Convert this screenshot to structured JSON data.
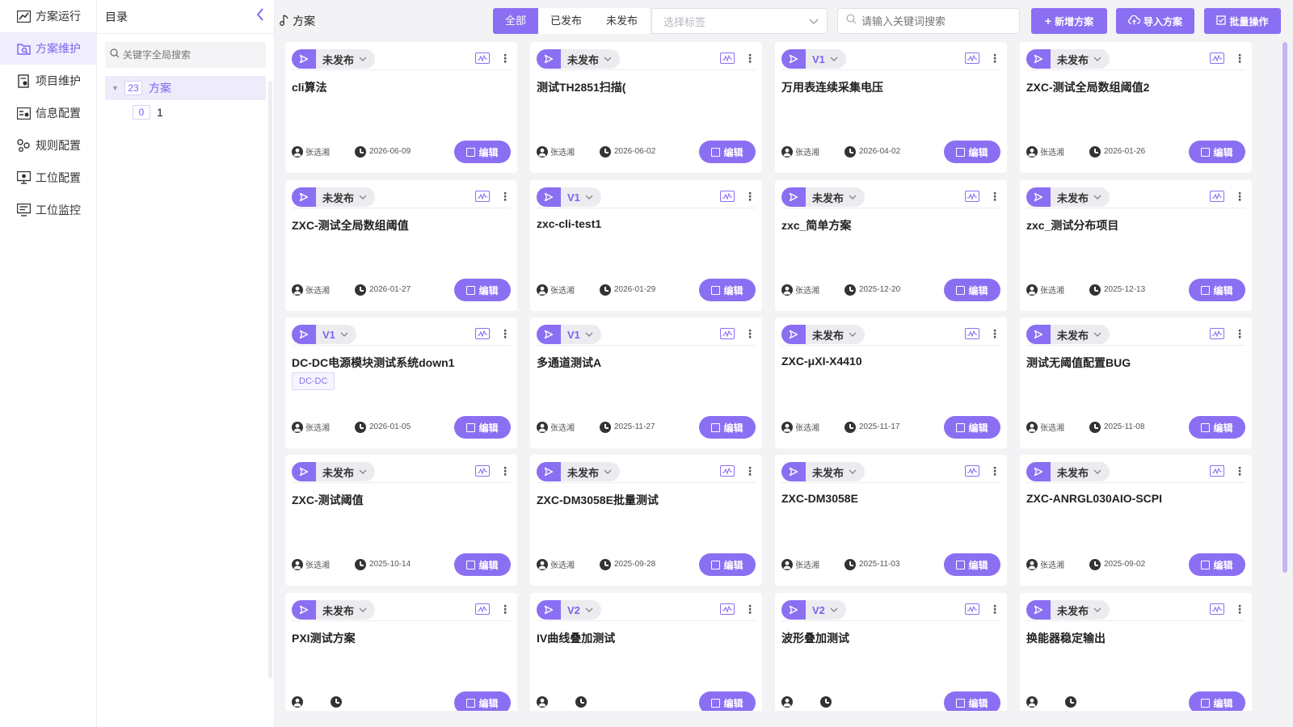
{
  "nav": [
    {
      "label": "方案运行",
      "icon": "chart-line-icon",
      "active": false
    },
    {
      "label": "方案维护",
      "icon": "folder-search-icon",
      "active": true
    },
    {
      "label": "项目维护",
      "icon": "document-gear-icon",
      "active": false
    },
    {
      "label": "信息配置",
      "icon": "info-config-icon",
      "active": false
    },
    {
      "label": "规则配置",
      "icon": "rules-icon",
      "active": false
    },
    {
      "label": "工位配置",
      "icon": "monitor-gear-icon",
      "active": false
    },
    {
      "label": "工位监控",
      "icon": "monitor-list-icon",
      "active": false
    }
  ],
  "directory": {
    "title": "目录",
    "search_placeholder": "关键字全局搜索",
    "tree": [
      {
        "count": "23",
        "label": "方案"
      },
      {
        "count": "0",
        "label": "1"
      }
    ]
  },
  "topbar": {
    "crumb": "方案",
    "filters": [
      "全部",
      "已发布",
      "未发布"
    ],
    "tag_placeholder": "选择标签",
    "search_placeholder": "请输入关键词搜索",
    "buttons": [
      "新增方案",
      "导入方案",
      "批量操作"
    ]
  },
  "edit_label": "编辑",
  "cards": [
    {
      "status": "未发布",
      "title": "cli算法",
      "author": "张选湘",
      "date": "2026-06-09"
    },
    {
      "status": "未发布",
      "title": "测试TH2851扫描(",
      "author": "张选湘",
      "date": "2026-06-02"
    },
    {
      "status": "V1",
      "title": "万用表连续采集电压",
      "author": "张选湘",
      "date": "2026-04-02"
    },
    {
      "status": "未发布",
      "title": "ZXC-测试全局数组阈值2",
      "author": "张选湘",
      "date": "2026-01-26"
    },
    {
      "status": "未发布",
      "title": "ZXC-测试全局数组阈值",
      "author": "张选湘",
      "date": "2026-01-27"
    },
    {
      "status": "V1",
      "title": "zxc-cli-test1",
      "author": "张选湘",
      "date": "2026-01-29"
    },
    {
      "status": "未发布",
      "title": "zxc_简单方案",
      "author": "张选湘",
      "date": "2025-12-20"
    },
    {
      "status": "未发布",
      "title": "zxc_测试分布项目",
      "author": "张选湘",
      "date": "2025-12-13"
    },
    {
      "status": "V1",
      "title": "DC-DC电源模块测试系统down1",
      "tag": "DC-DC",
      "author": "张选湘",
      "date": "2026-01-05"
    },
    {
      "status": "V1",
      "title": "多通道测试A",
      "author": "张选湘",
      "date": "2025-11-27"
    },
    {
      "status": "未发布",
      "title": "ZXC-μXI-X4410",
      "author": "张选湘",
      "date": "2025-11-17"
    },
    {
      "status": "未发布",
      "title": "测试无阈值配置BUG",
      "author": "张选湘",
      "date": "2025-11-08"
    },
    {
      "status": "未发布",
      "title": "ZXC-测试阈值",
      "author": "张选湘",
      "date": "2025-10-14"
    },
    {
      "status": "未发布",
      "title": "ZXC-DM3058E批量测试",
      "author": "张选湘",
      "date": "2025-09-28"
    },
    {
      "status": "未发布",
      "title": "ZXC-DM3058E",
      "author": "张选湘",
      "date": "2025-11-03"
    },
    {
      "status": "未发布",
      "title": "ZXC-ANRGL030AIO-SCPI",
      "author": "张选湘",
      "date": "2025-09-02"
    },
    {
      "status": "未发布",
      "title": "PXI测试方案",
      "author": "",
      "date": ""
    },
    {
      "status": "V2",
      "title": "IV曲线叠加测试",
      "author": "",
      "date": ""
    },
    {
      "status": "V2",
      "title": "波形叠加测试",
      "author": "",
      "date": ""
    },
    {
      "status": "未发布",
      "title": "换能器稳定输出",
      "author": "",
      "date": ""
    }
  ],
  "colors": {
    "accent": "#8b6ff2",
    "active_bg": "#f0eefc"
  }
}
